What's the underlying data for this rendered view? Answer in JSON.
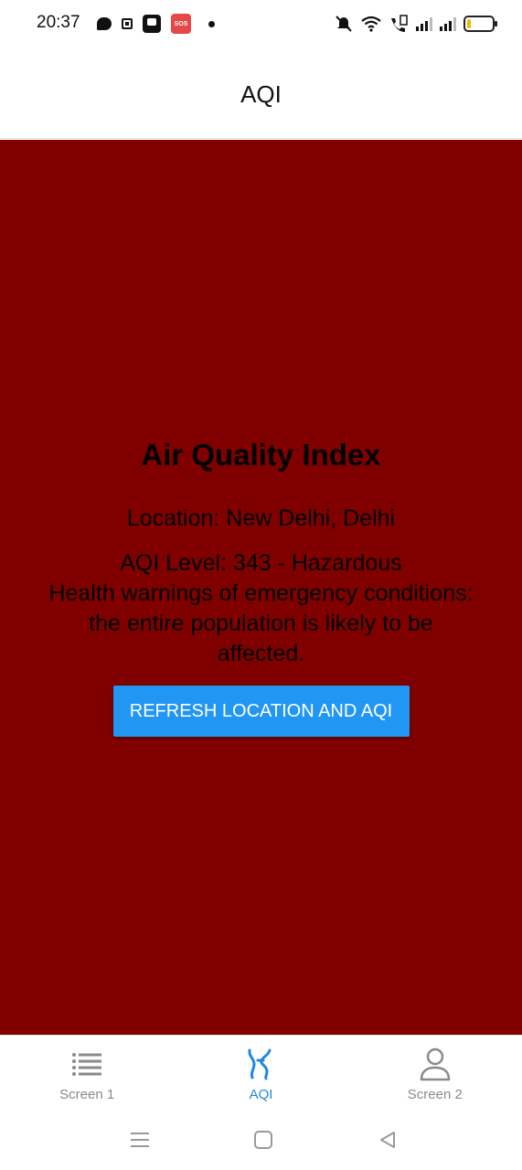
{
  "status_bar": {
    "time": "20:37",
    "sos_label": "SOS",
    "left_icons": [
      "chat-bubble-icon",
      "small-app-icon",
      "media-icon",
      "sos-icon",
      "notification-dot-icon"
    ],
    "right_icons": [
      "silent-icon",
      "wifi-icon",
      "volte-icon",
      "signal-icon",
      "signal-icon",
      "battery-icon"
    ],
    "battery_level": 0.15
  },
  "app_bar": {
    "title": "AQI"
  },
  "main": {
    "background_color": "#800000",
    "heading": "Air Quality Index",
    "location": "Location: New Delhi, Delhi",
    "aqi_level": "AQI Level: 343 - Hazardous",
    "health_message": "Health warnings of emergency conditions: the entire population is likely to be affected.",
    "refresh_button": "REFRESH LOCATION AND AQI",
    "button_color": "#2196f3"
  },
  "bottom_nav": {
    "items": [
      {
        "label": "Screen 1",
        "icon": "list-icon",
        "active": false
      },
      {
        "label": "AQI",
        "icon": "lungs-icon",
        "active": true
      },
      {
        "label": "Screen 2",
        "icon": "person-icon",
        "active": false
      }
    ],
    "active_color": "#2188e0"
  },
  "system_nav": {
    "icons": [
      "recent-apps-icon",
      "home-icon",
      "back-icon"
    ]
  }
}
